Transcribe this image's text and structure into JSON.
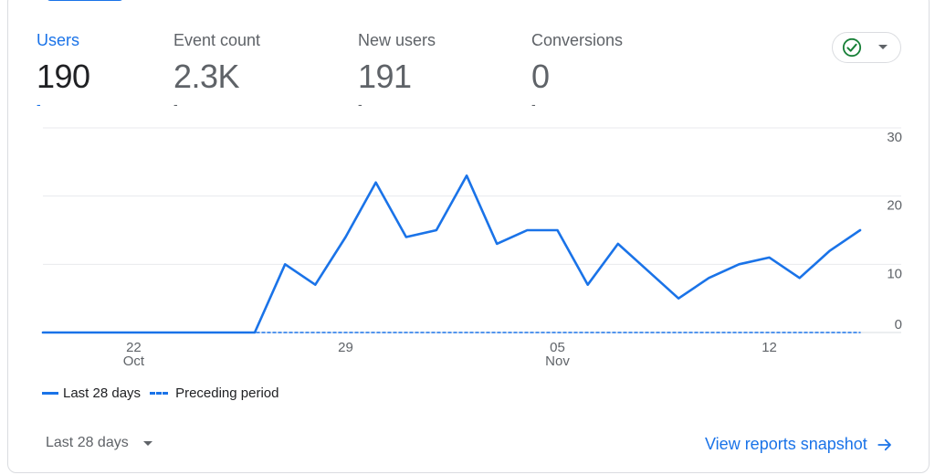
{
  "metrics": [
    {
      "label": "Users",
      "value": "190",
      "delta": "-",
      "active": true
    },
    {
      "label": "Event count",
      "value": "2.3K",
      "delta": "-",
      "active": false
    },
    {
      "label": "New users",
      "value": "191",
      "delta": "-",
      "active": false
    },
    {
      "label": "Conversions",
      "value": "0",
      "delta": "-",
      "active": false
    }
  ],
  "status": {
    "icon": "check-circle-icon",
    "color": "#188038"
  },
  "legend": {
    "current": "Last 28 days",
    "previous": "Preceding period"
  },
  "date_range": {
    "label": "Last 28 days"
  },
  "footer": {
    "link_label": "View reports snapshot"
  },
  "colors": {
    "accent": "#1a73e8",
    "grid": "#e8eaed",
    "axis_text": "#5f6368"
  },
  "chart_data": {
    "type": "line",
    "x": [
      "Oct 19",
      "Oct 20",
      "Oct 21",
      "Oct 22",
      "Oct 23",
      "Oct 24",
      "Oct 25",
      "Oct 26",
      "Oct 27",
      "Oct 28",
      "Oct 29",
      "Oct 30",
      "Oct 31",
      "Nov 1",
      "Nov 2",
      "Nov 3",
      "Nov 4",
      "Nov 5",
      "Nov 6",
      "Nov 7",
      "Nov 8",
      "Nov 9",
      "Nov 10",
      "Nov 11",
      "Nov 12",
      "Nov 13",
      "Nov 14",
      "Nov 15"
    ],
    "x_ticks": [
      {
        "index": 3,
        "label": "22",
        "sublabel": "Oct"
      },
      {
        "index": 10,
        "label": "29",
        "sublabel": ""
      },
      {
        "index": 17,
        "label": "05",
        "sublabel": "Nov"
      },
      {
        "index": 24,
        "label": "12",
        "sublabel": ""
      }
    ],
    "y_ticks": [
      0,
      10,
      20,
      30
    ],
    "ylim": [
      0,
      30
    ],
    "series": [
      {
        "name": "Last 28 days",
        "style": "solid",
        "values": [
          0,
          0,
          0,
          0,
          0,
          0,
          0,
          0,
          10,
          7,
          14,
          22,
          14,
          15,
          23,
          13,
          15,
          15,
          7,
          13,
          9,
          5,
          8,
          10,
          11,
          8,
          12,
          15
        ]
      },
      {
        "name": "Preceding period",
        "style": "dashed",
        "values": [
          0,
          0,
          0,
          0,
          0,
          0,
          0,
          0,
          0,
          0,
          0,
          0,
          0,
          0,
          0,
          0,
          0,
          0,
          0,
          0,
          0,
          0,
          0,
          0,
          0,
          0,
          0,
          0
        ]
      }
    ],
    "grid": true,
    "legend_position": "bottom-left"
  }
}
